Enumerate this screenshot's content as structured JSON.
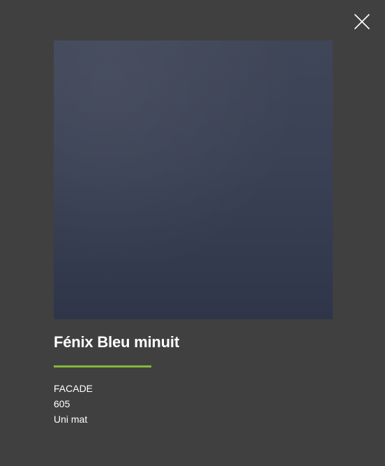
{
  "modal": {
    "close_icon": "close-icon",
    "swatch_color": "#3a4154",
    "title": "Fénix Bleu minuit",
    "accent_color": "#84b838",
    "details": {
      "category": "FACADE",
      "code": "605",
      "finish": "Uni mat"
    }
  }
}
